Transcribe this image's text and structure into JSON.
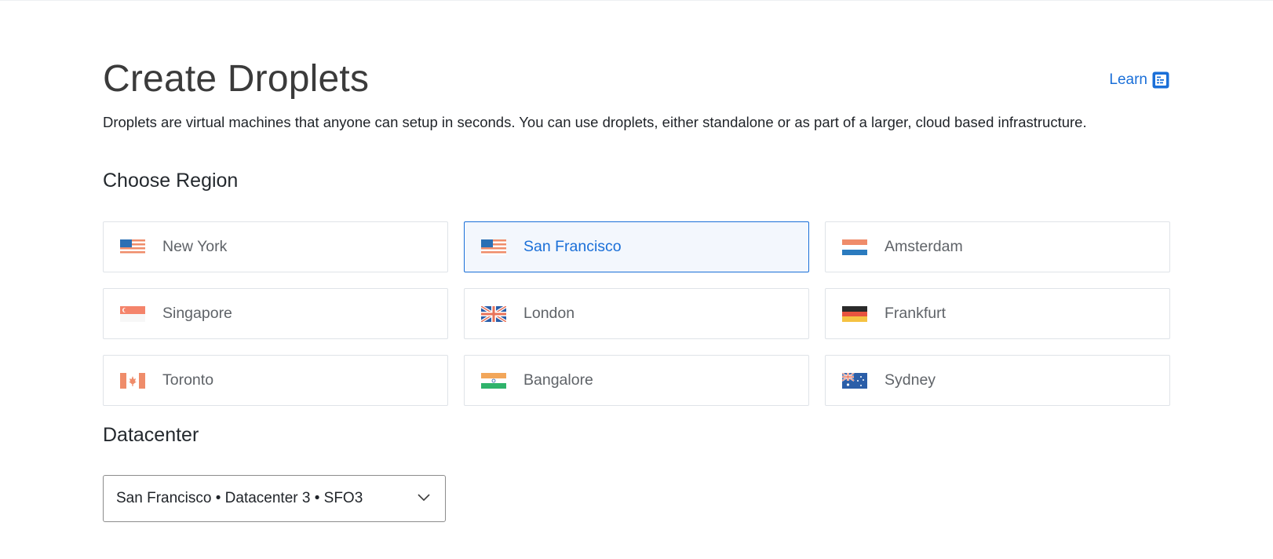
{
  "page": {
    "title": "Create Droplets",
    "learn_label": "Learn",
    "description": "Droplets are virtual machines that anyone can setup in seconds. You can use droplets, either standalone or as part of a larger, cloud based infrastructure."
  },
  "region_section": {
    "heading": "Choose Region",
    "selected": "San Francisco",
    "regions": [
      {
        "label": "New York",
        "flag": "us-flag-icon"
      },
      {
        "label": "San Francisco",
        "flag": "us-flag-icon"
      },
      {
        "label": "Amsterdam",
        "flag": "netherlands-flag-icon"
      },
      {
        "label": "Singapore",
        "flag": "singapore-flag-icon"
      },
      {
        "label": "London",
        "flag": "uk-flag-icon"
      },
      {
        "label": "Frankfurt",
        "flag": "germany-flag-icon"
      },
      {
        "label": "Toronto",
        "flag": "canada-flag-icon"
      },
      {
        "label": "Bangalore",
        "flag": "india-flag-icon"
      },
      {
        "label": "Sydney",
        "flag": "australia-flag-icon"
      }
    ]
  },
  "datacenter_section": {
    "heading": "Datacenter",
    "selected_value": "San Francisco • Datacenter 3 • SFO3"
  },
  "colors": {
    "accent": "#1a6fd8",
    "selected_bg": "#f3f7fd",
    "card_border": "#dfe3e8"
  },
  "icons": {
    "learn": "document-icon",
    "dropdown": "chevron-down-icon"
  }
}
